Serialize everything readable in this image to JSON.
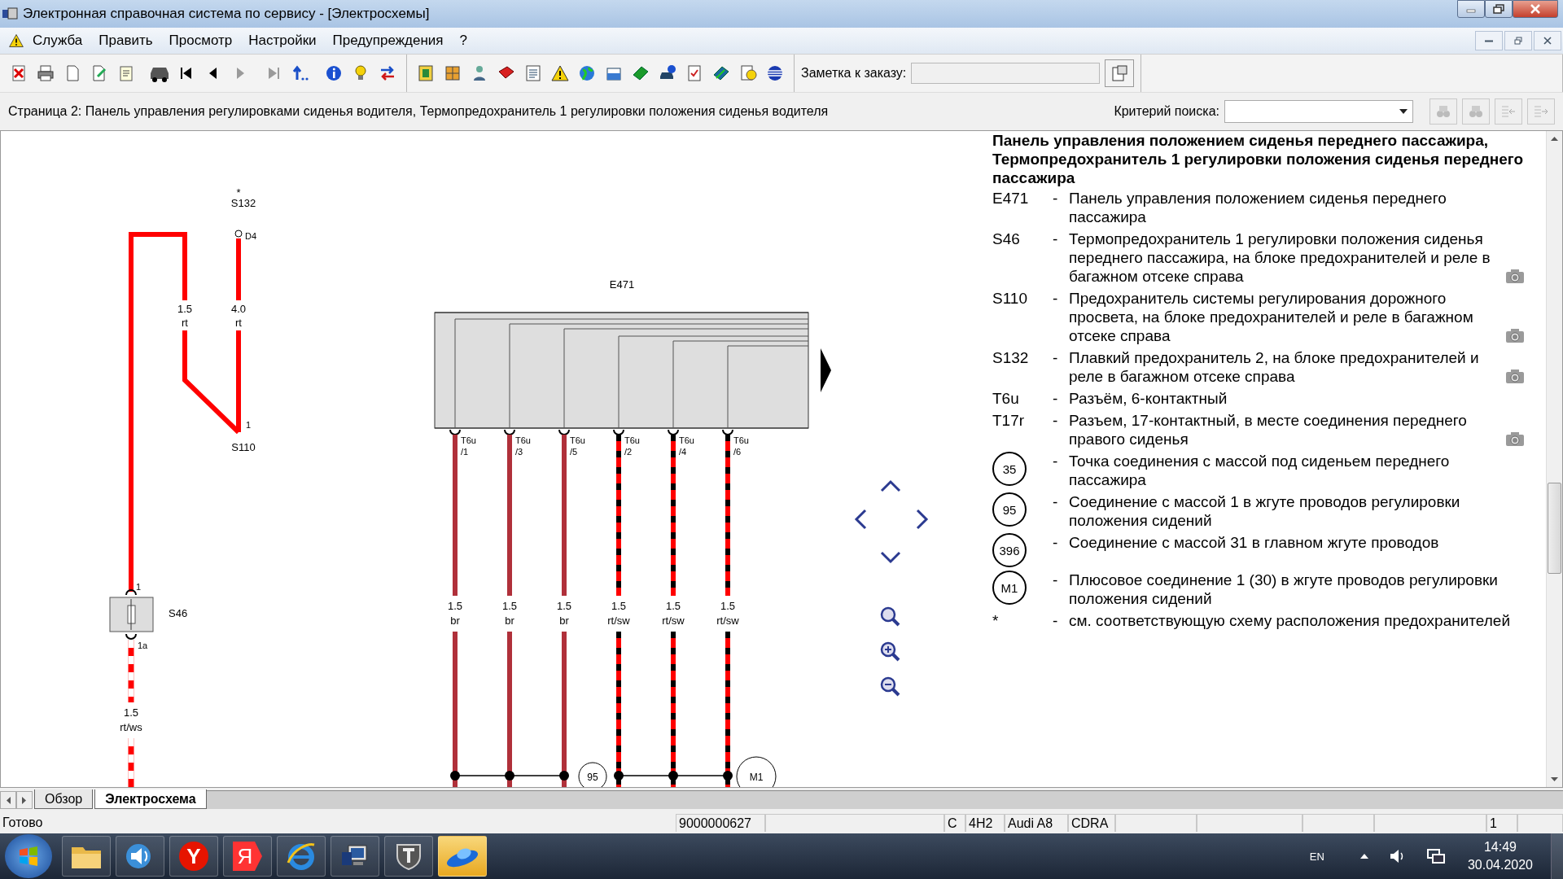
{
  "window": {
    "title": "Электронная справочная система по сервису - [Электросхемы]"
  },
  "menu": [
    {
      "label": "Служба"
    },
    {
      "label": "Править"
    },
    {
      "label": "Просмотр"
    },
    {
      "label": "Настройки"
    },
    {
      "label": "Предупреждения"
    },
    {
      "label": "?"
    }
  ],
  "order_note": {
    "label": "Заметка к заказу:"
  },
  "page_line": {
    "text": "Страница 2: Панель управления регулировками сиденья водителя, Термопредохранитель 1 регулировки положения сиденья водителя",
    "search_label": "Критерий поиска:"
  },
  "schematic": {
    "s132": {
      "mark": "*",
      "label": "S132",
      "pin": "D4"
    },
    "top_wires": [
      {
        "size": "1.5",
        "color_code": "rt",
        "kind": "red"
      },
      {
        "size": "4.0",
        "color_code": "rt",
        "kind": "red"
      }
    ],
    "s110": {
      "label": "S110",
      "pin": "1"
    },
    "s46": {
      "label": "S46",
      "pin_in": "1",
      "pin_out": "1a",
      "wire": {
        "size": "1.5",
        "color_code": "rt/ws",
        "kind": "striped_white"
      }
    },
    "module": {
      "label": "E471",
      "pins": [
        {
          "connector": "T6u",
          "pin": "/1",
          "size": "1.5",
          "color_code": "br",
          "kind": "brown"
        },
        {
          "connector": "T6u",
          "pin": "/3",
          "size": "1.5",
          "color_code": "br",
          "kind": "brown"
        },
        {
          "connector": "T6u",
          "pin": "/5",
          "size": "1.5",
          "color_code": "br",
          "kind": "brown"
        },
        {
          "connector": "T6u",
          "pin": "/2",
          "size": "1.5",
          "color_code": "rt/sw",
          "kind": "striped_black"
        },
        {
          "connector": "T6u",
          "pin": "/4",
          "size": "1.5",
          "color_code": "rt/sw",
          "kind": "striped_black"
        },
        {
          "connector": "T6u",
          "pin": "/6",
          "size": "1.5",
          "color_code": "rt/sw",
          "kind": "striped_black"
        }
      ]
    },
    "grounds": [
      {
        "label": "95"
      },
      {
        "label": "M1"
      }
    ]
  },
  "legend": {
    "heading": "Панель управления положением сиденья переднего пассажира, Термопредохранитель 1 регулировки положения сиденья переднего пассажира",
    "items": [
      {
        "code": "E471",
        "kind": "text",
        "separator": "-",
        "text": "Панель управления положением сиденья переднего пассажира",
        "photo": false
      },
      {
        "code": "S46",
        "kind": "text",
        "separator": "-",
        "text": "Термопредохранитель 1 регулировки положения сиденья переднего пассажира, на блоке предохранителей и реле в багажном отсеке справа",
        "photo": true
      },
      {
        "code": "S110",
        "kind": "text",
        "separator": "-",
        "text": "Предохранитель системы регулирования дорожного просвета, на блоке предохранителей и реле в багажном отсеке справа",
        "photo": true
      },
      {
        "code": "S132",
        "kind": "text",
        "separator": "-",
        "text": "Плавкий предохранитель 2, на блоке предохранителей и реле в багажном отсеке справа",
        "photo": true
      },
      {
        "code": "T6u",
        "kind": "text",
        "separator": "-",
        "text": "Разъём, 6-контактный",
        "photo": false
      },
      {
        "code": "T17r",
        "kind": "text",
        "separator": "-",
        "text": "Разъем, 17-контактный, в месте соединения переднего правого сиденья",
        "photo": true
      },
      {
        "code": "35",
        "kind": "circle",
        "separator": "-",
        "text": "Точка соединения с массой под сиденьем переднего пассажира",
        "photo": false
      },
      {
        "code": "95",
        "kind": "circle",
        "separator": "-",
        "text": "Соединение с массой 1 в жгуте проводов регулировки положения сидений",
        "photo": false
      },
      {
        "code": "396",
        "kind": "circle",
        "separator": "-",
        "text": "Соединение с массой 31 в главном жгуте проводов",
        "photo": false
      },
      {
        "code": "M1",
        "kind": "circle",
        "separator": "-",
        "text": "Плюсовое соединение 1 (30) в жгуте проводов регулировки положения сидений",
        "photo": false
      },
      {
        "code": "*",
        "kind": "text",
        "separator": "-",
        "text": "см. соответствующую схему расположения предохранителей",
        "photo": false
      }
    ]
  },
  "tabs": [
    {
      "label": "Обзор",
      "selected": false
    },
    {
      "label": "Электросхема",
      "selected": true
    }
  ],
  "status_bar": {
    "cells": [
      "Готово",
      "9000000627",
      "C",
      "4H2",
      "Audi A8",
      "CDRA",
      "1"
    ]
  },
  "taskbar": {
    "apps": [
      {
        "kind": "folder",
        "active": false
      },
      {
        "kind": "speaker",
        "active": false
      },
      {
        "kind": "round_glyph",
        "glyph": "Y",
        "active": false
      },
      {
        "kind": "tag_glyph",
        "glyph": "Я",
        "active": false
      },
      {
        "kind": "browser",
        "active": false
      },
      {
        "kind": "computer",
        "active": false
      },
      {
        "kind": "shield",
        "active": false
      },
      {
        "kind": "disc",
        "active": true
      }
    ],
    "language": "EN",
    "time": "14:49",
    "date": "30.04.2020"
  }
}
